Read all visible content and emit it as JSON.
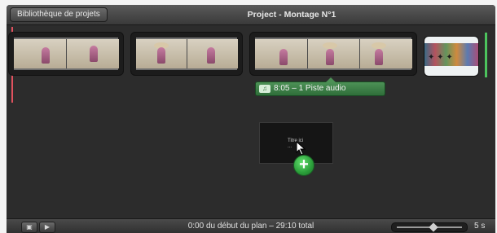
{
  "header": {
    "back_button_label": "Bibliothèque de projets",
    "title": "Project - Montage N°1"
  },
  "timeline": {
    "audio_tag": {
      "text": "8:05 – 1 Piste audio",
      "icon": "audio-track-icon"
    },
    "drop_preview": {
      "text_line1": "Titre ici",
      "text_line2": "..."
    },
    "add_icon": "plus-circle-icon"
  },
  "bottom": {
    "status_text": "0:00 du début du plan – 29:10 total",
    "zoom_label": "5 s",
    "camera_icon": "camera-icon",
    "play_icon": "play-icon",
    "zoom_level": 0.5
  },
  "colors": {
    "playhead": "#e0525e",
    "audio": "#4d9156",
    "accent_green": "#4cc35d"
  }
}
